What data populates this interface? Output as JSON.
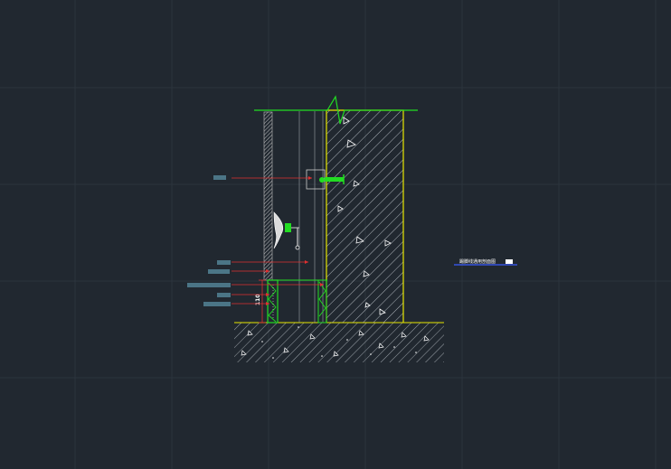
{
  "drawing": {
    "section_title": "踢脚线通用剖面图",
    "dimension_value": "110",
    "colors": {
      "background": "#212830",
      "grid": "#2c343d",
      "concrete_outline": "#e6e600",
      "finish_line": "#22dd22",
      "leader": "#e03030",
      "hatch": "#cfd6dc",
      "label_chip": "#4b7586",
      "title_underline": "#3b5bff"
    },
    "annotations": [
      {
        "label": "",
        "target": "wall-anchor-bolt"
      },
      {
        "label": "",
        "target": "wall-finish-panel"
      },
      {
        "label": "",
        "target": "substrate-layer"
      },
      {
        "label": "",
        "target": "skirting-board-top"
      },
      {
        "label": "",
        "target": "skirting-board"
      },
      {
        "label": "",
        "target": "skirting-base"
      }
    ]
  }
}
